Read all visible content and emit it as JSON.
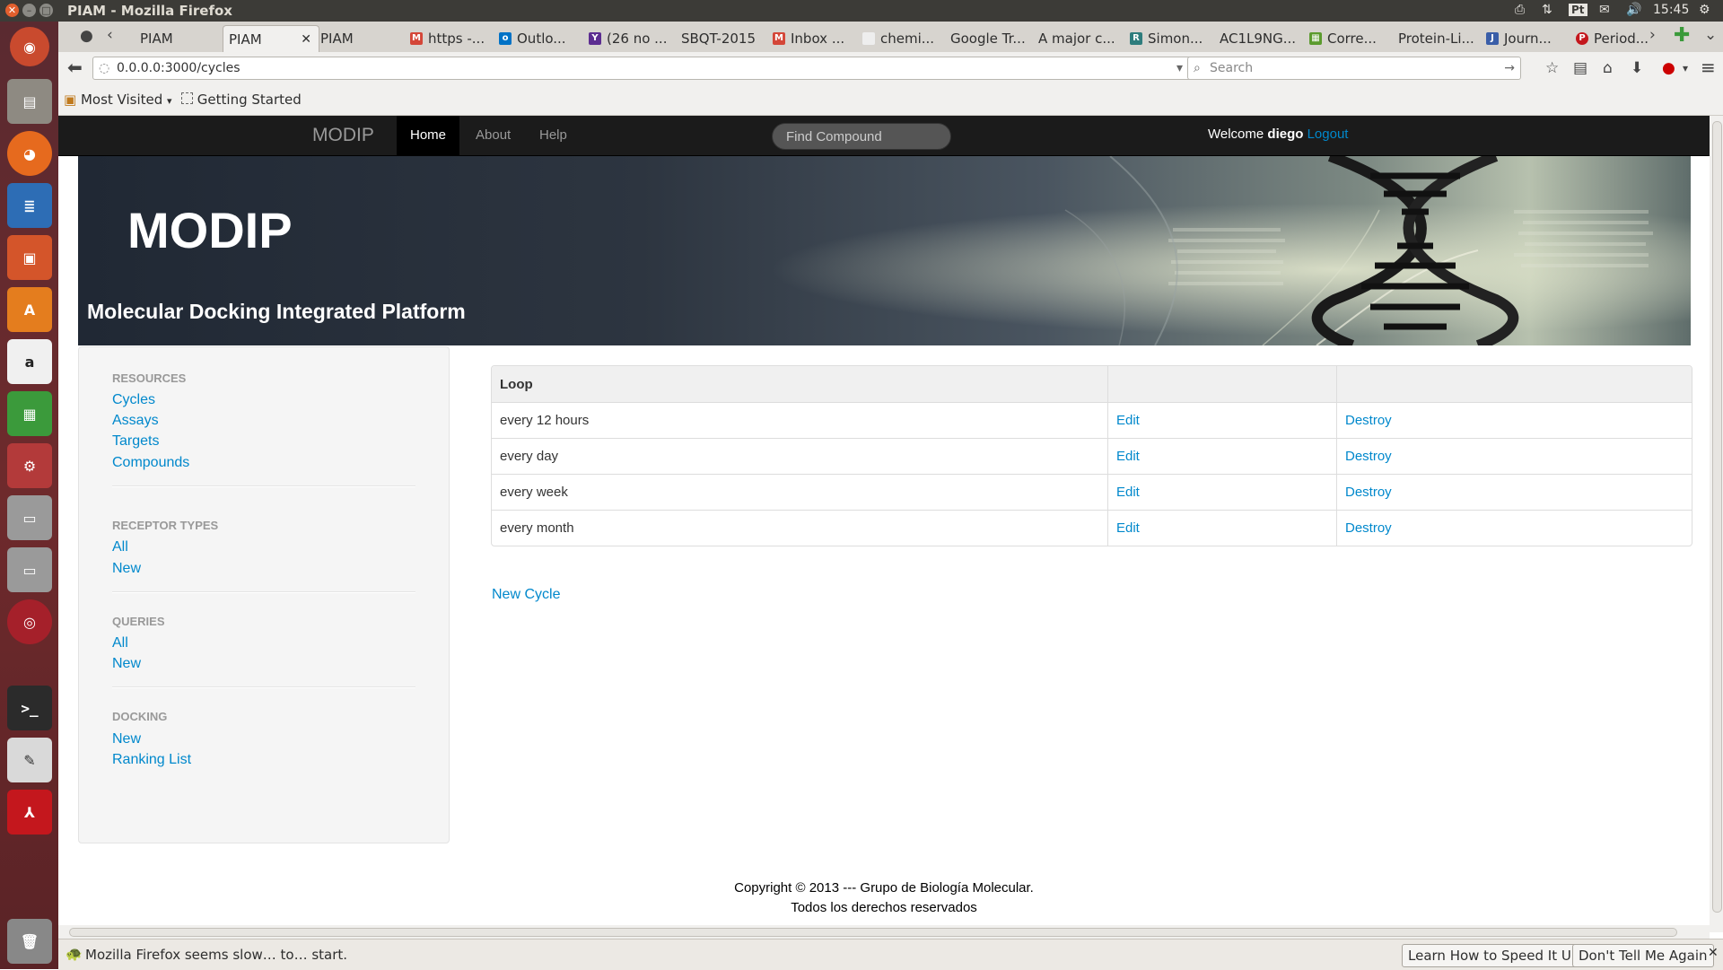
{
  "panel": {
    "window_title": "PIAM - Mozilla Firefox",
    "time": "15:45",
    "keyboard": "Pt"
  },
  "tabs": [
    {
      "label": "PIAM"
    },
    {
      "label": "PIAM"
    },
    {
      "label": "PIAM"
    },
    {
      "label": "https -..."
    },
    {
      "label": "Outlo..."
    },
    {
      "label": "(26 no ..."
    },
    {
      "label": "SBQT-2015"
    },
    {
      "label": "Inbox ..."
    },
    {
      "label": "chemi..."
    },
    {
      "label": "Google Tr..."
    },
    {
      "label": "A major c..."
    },
    {
      "label": "Simon..."
    },
    {
      "label": "AC1L9NG..."
    },
    {
      "label": "Corre..."
    },
    {
      "label": "Protein-Li..."
    },
    {
      "label": "Journ..."
    },
    {
      "label": "Period..."
    }
  ],
  "urlbar": {
    "url": "0.0.0.0:3000/cycles",
    "search_placeholder": "Search"
  },
  "bookmarks": {
    "most_visited": "Most Visited",
    "getting_started": "Getting Started"
  },
  "site": {
    "brand": "MODIP",
    "nav": {
      "home": "Home",
      "about": "About",
      "help": "Help"
    },
    "find_placeholder": "Find Compound",
    "welcome": {
      "prefix": "Welcome",
      "user": "diego",
      "logout": "Logout"
    },
    "hero": {
      "title": "MODIP",
      "subtitle": "Molecular Docking Integrated Platform"
    },
    "sidebar": {
      "resources_header": "RESOURCES",
      "cycles": "Cycles",
      "assays": "Assays",
      "targets": "Targets",
      "compounds": "Compounds",
      "receptor_header": "RECEPTOR TYPES",
      "receptor_all": "All",
      "receptor_new": "New",
      "queries_header": "QUERIES",
      "queries_all": "All",
      "queries_new": "New",
      "docking_header": "DOCKING",
      "docking_new": "New",
      "ranking_list": "Ranking List"
    },
    "table": {
      "header": "Loop",
      "rows": [
        {
          "loop": "every 12 hours",
          "edit": "Edit",
          "destroy": "Destroy"
        },
        {
          "loop": "every day",
          "edit": "Edit",
          "destroy": "Destroy"
        },
        {
          "loop": "every week",
          "edit": "Edit",
          "destroy": "Destroy"
        },
        {
          "loop": "every month",
          "edit": "Edit",
          "destroy": "Destroy"
        }
      ]
    },
    "new_cycle": "New Cycle",
    "footer": {
      "line1": "Copyright © 2013 --- Grupo de Biología Molecular.",
      "line2": "Todos los derechos reservados"
    }
  },
  "notification": {
    "message": "Mozilla Firefox seems slow… to… start.",
    "learn": "Learn How to Speed It Up",
    "dismiss": "Don't Tell Me Again"
  }
}
